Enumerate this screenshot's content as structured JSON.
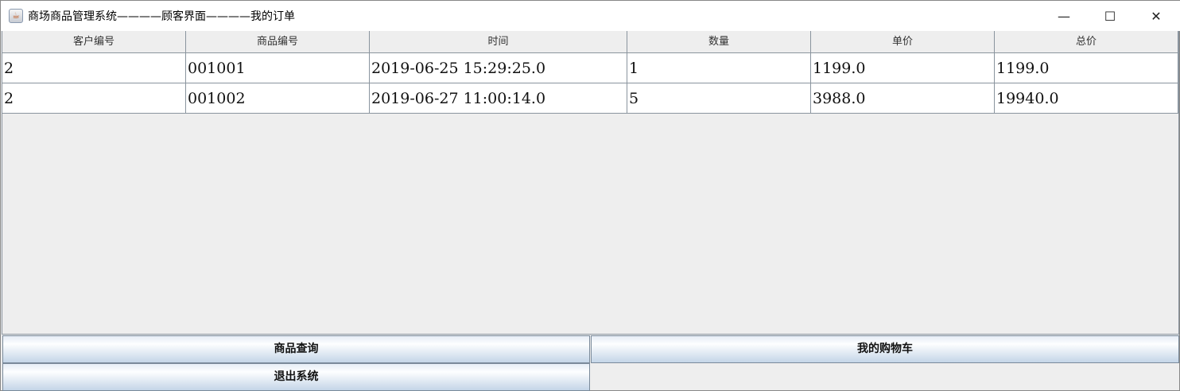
{
  "window": {
    "title": "商场商品管理系统————顾客界面————我的订单",
    "minimize_icon": "minimize-icon",
    "maximize_icon": "maximize-icon",
    "close_icon": "close-icon"
  },
  "table": {
    "columns": [
      "客户编号",
      "商品编号",
      "时间",
      "数量",
      "单价",
      "总价"
    ],
    "rows": [
      [
        "2",
        "001001",
        "2019-06-25 15:29:25.0",
        "1",
        "1199.0",
        "1199.0"
      ],
      [
        "2",
        "001002",
        "2019-06-27 11:00:14.0",
        "5",
        "3988.0",
        "19940.0"
      ]
    ]
  },
  "buttons": {
    "search": "商品查询",
    "cart": "我的购物车",
    "exit": "退出系统"
  }
}
